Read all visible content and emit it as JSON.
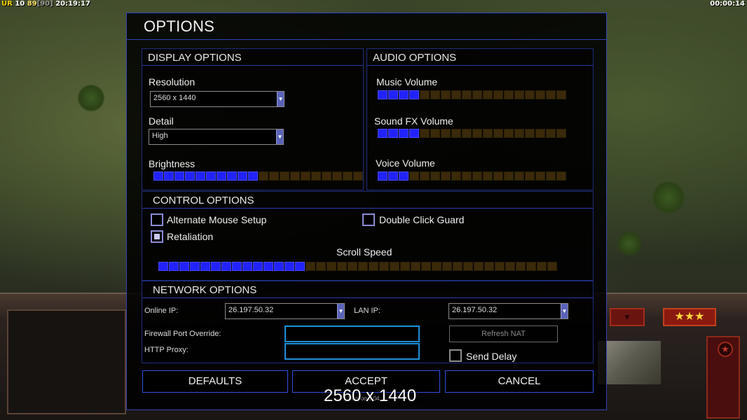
{
  "hud": {
    "ur_label": "UR",
    "ur_value": "10",
    "fps": "89",
    "fps_max": "[90]",
    "clock": "20:19:17",
    "game_timer": "00:00:14"
  },
  "dialog": {
    "title": "OPTIONS",
    "display": {
      "heading": "DISPLAY OPTIONS",
      "resolution_label": "Resolution",
      "resolution_value": "2560 x 1440",
      "detail_label": "Detail",
      "detail_value": "High",
      "brightness_label": "Brightness",
      "brightness_level": 10,
      "brightness_segments": 20
    },
    "audio": {
      "heading": "AUDIO OPTIONS",
      "music_label": "Music Volume",
      "music_level": 4,
      "sfx_label": "Sound FX Volume",
      "sfx_level": 4,
      "voice_label": "Voice Volume",
      "voice_level": 3,
      "segments": 18
    },
    "control": {
      "heading": "CONTROL OPTIONS",
      "alternate_mouse_label": "Alternate Mouse Setup",
      "alternate_mouse_checked": false,
      "double_click_label": "Double Click Guard",
      "double_click_checked": false,
      "retaliation_label": "Retaliation",
      "retaliation_checked": true,
      "scroll_speed_label": "Scroll Speed",
      "scroll_speed_level": 14,
      "scroll_speed_segments": 38
    },
    "network": {
      "heading": "NETWORK OPTIONS",
      "online_ip_label": "Online IP:",
      "online_ip_value": "26.197.50.32",
      "lan_ip_label": "LAN IP:",
      "lan_ip_value": "26.197.50.32",
      "firewall_label": "Firewall Port Override:",
      "firewall_value": "",
      "http_proxy_label": "HTTP Proxy:",
      "http_proxy_value": "",
      "refresh_nat_label": "Refresh NAT",
      "send_delay_label": "Send Delay",
      "send_delay_checked": false
    },
    "buttons": {
      "defaults": "DEFAULTS",
      "accept": "ACCEPT",
      "cancel": "CANCEL"
    }
  },
  "overlay": {
    "resolution_text": "2560 x 1440",
    "version_text": "Version 1.04"
  },
  "colors": {
    "accent_border": "#3044b8",
    "slider_on": "#2222ff",
    "slider_off": "#3a2a0a",
    "input_border": "#1e8fd8"
  }
}
